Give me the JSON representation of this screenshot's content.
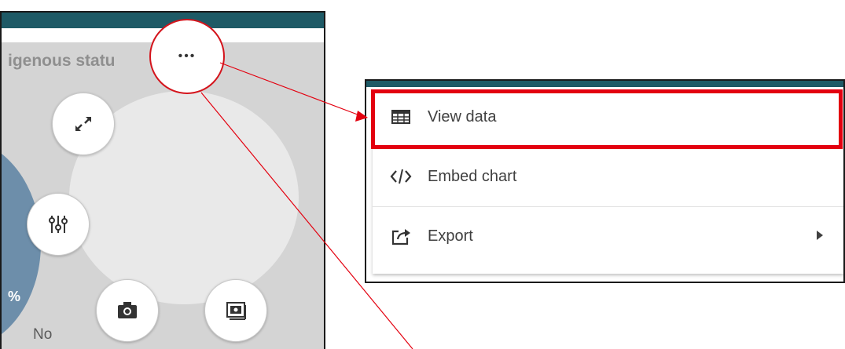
{
  "chart": {
    "title_fragment": "igenous statu",
    "pie_label": "%",
    "legend_no": "No"
  },
  "radial_menu": {
    "more_label": "•••",
    "buttons": [
      "expand-icon",
      "adjust-icon",
      "camera-icon",
      "snapshot-icon"
    ]
  },
  "context_menu": {
    "items": [
      {
        "label": "View data",
        "icon": "table-icon"
      },
      {
        "label": "Embed chart",
        "icon": "code-icon"
      },
      {
        "label": "Export",
        "icon": "export-icon",
        "has_submenu": true
      }
    ]
  },
  "colors": {
    "teal_header": "#1e5a66",
    "annotation_red": "#e3000f",
    "pie_blue": "#6d8eaa"
  }
}
